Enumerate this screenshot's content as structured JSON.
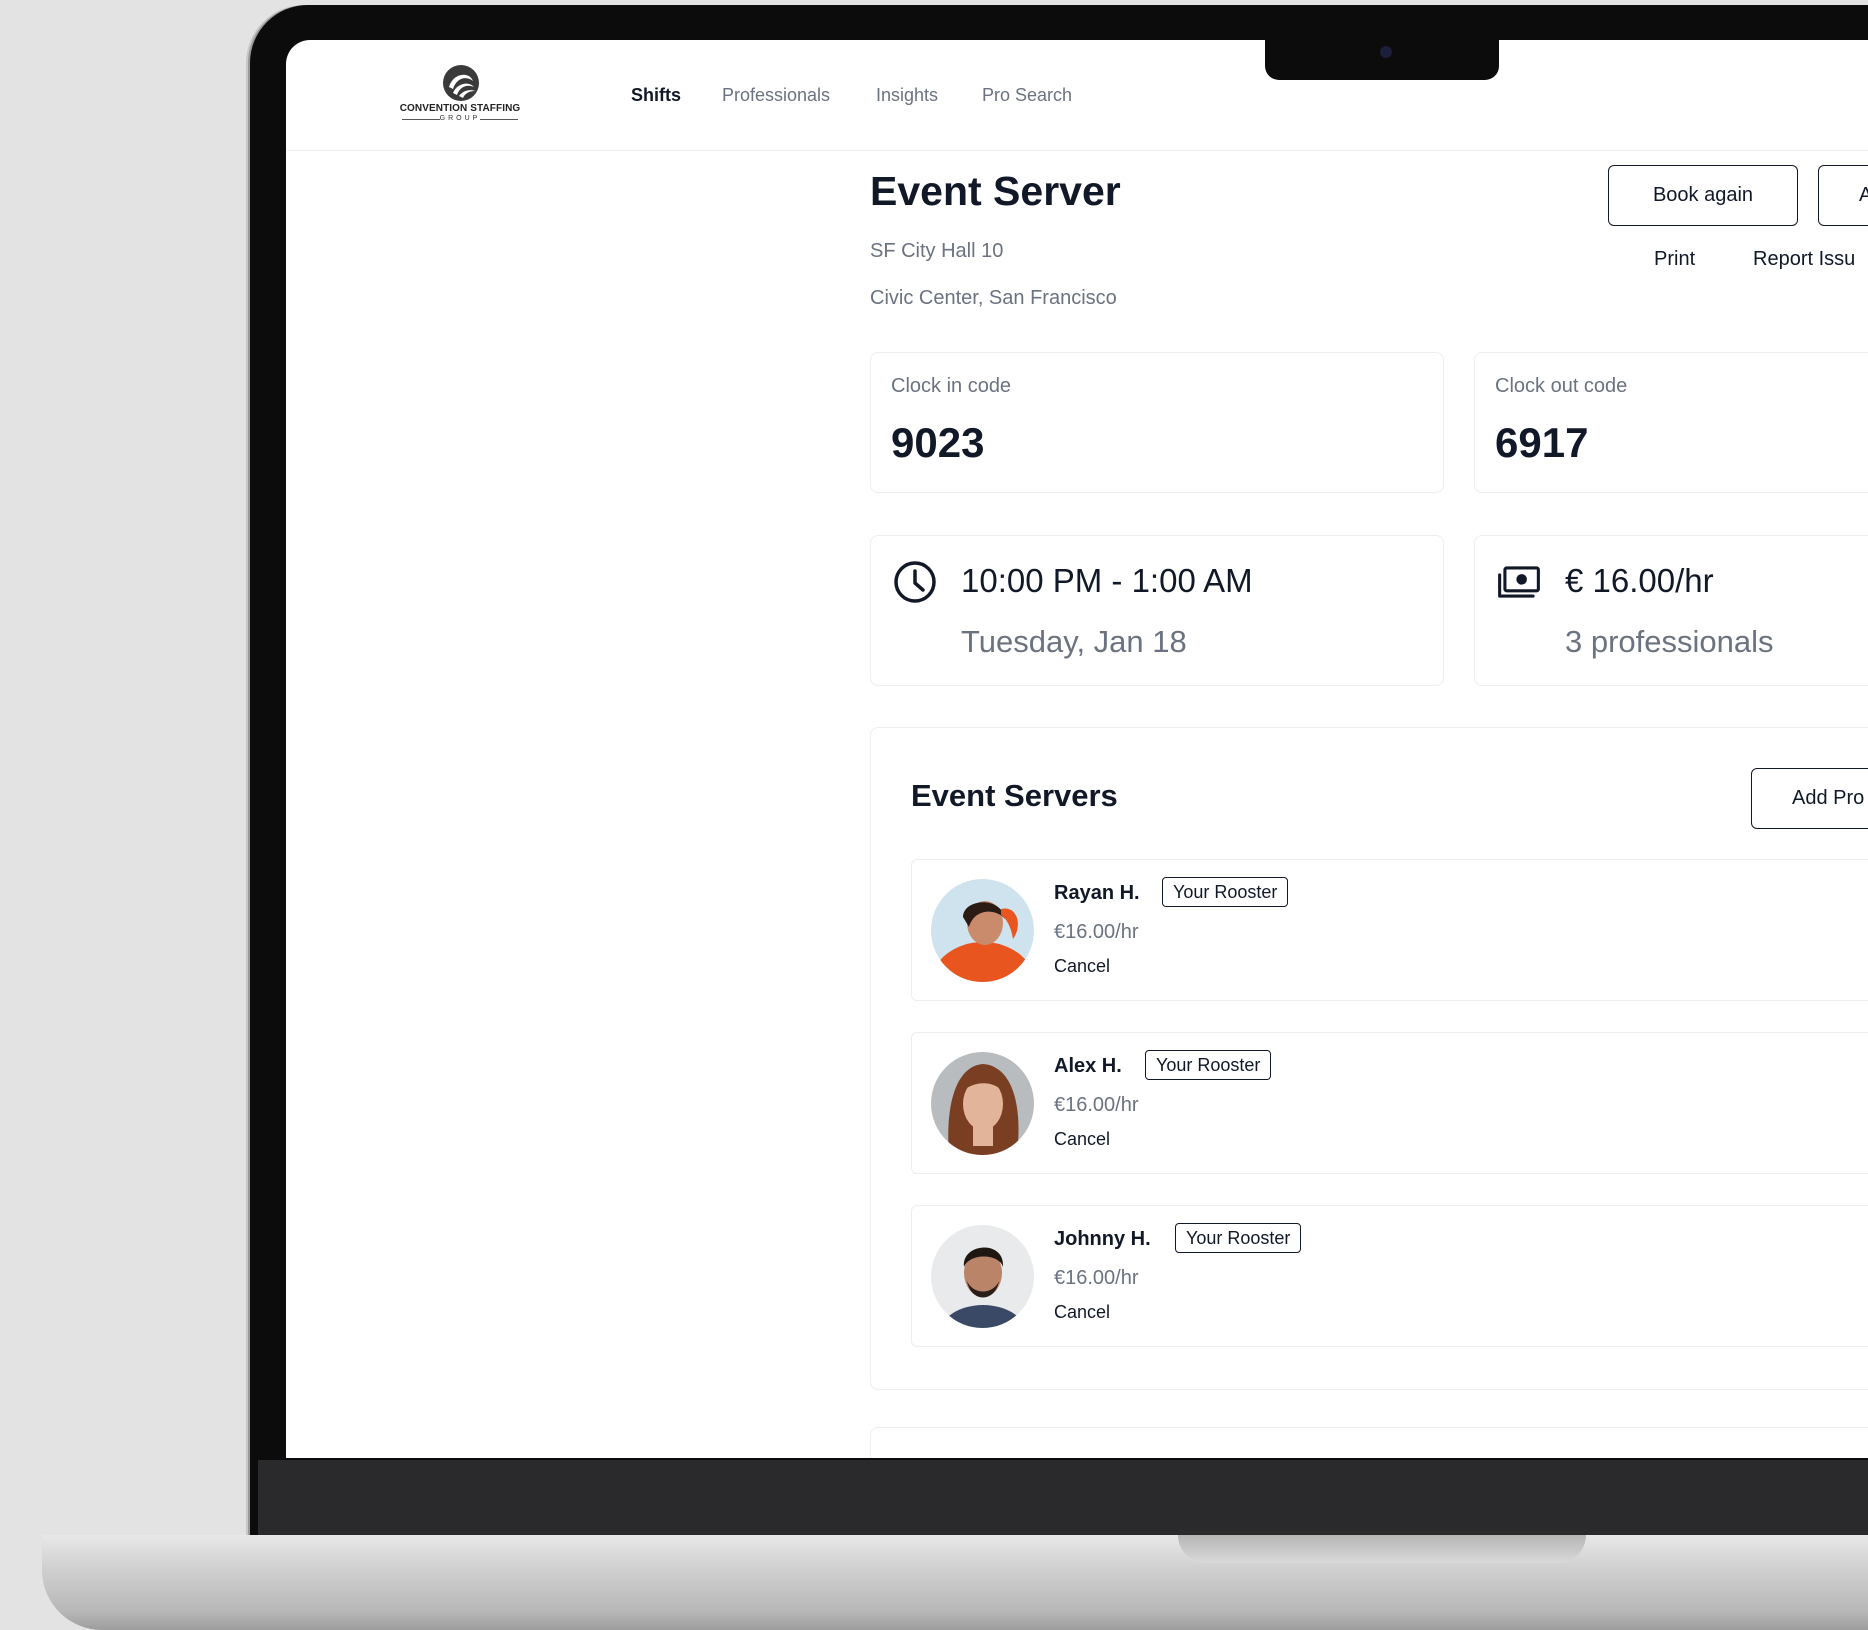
{
  "nav": {
    "logo_text": "CONVENTION STAFFING",
    "logo_sub": "GROUP",
    "items": [
      {
        "label": "Shifts",
        "active": true
      },
      {
        "label": "Professionals",
        "active": false
      },
      {
        "label": "Insights",
        "active": false
      },
      {
        "label": "Pro Search",
        "active": false
      }
    ]
  },
  "shift": {
    "title": "Event Server",
    "venue": "SF City Hall 10",
    "location": "Civic Center, San Francisco"
  },
  "actions": {
    "book_again": "Book again",
    "second_button": "A",
    "print": "Print",
    "report_issue": "Report Issu"
  },
  "codes": {
    "clock_in_label": "Clock in code",
    "clock_in_value": "9023",
    "clock_out_label": "Clock out code",
    "clock_out_value": "6917"
  },
  "details": {
    "time_range": "10:00 PM - 1:00 AM",
    "date": "Tuesday, Jan 18",
    "rate": "€ 16.00/hr",
    "professionals": "3 professionals"
  },
  "panel": {
    "title": "Event Servers",
    "add_button": "Add Pro",
    "pros": [
      {
        "name": "Rayan H.",
        "badge": "Your Rooster",
        "rate": "€16.00/hr",
        "cancel": "Cancel"
      },
      {
        "name": "Alex H.",
        "badge": "Your Rooster",
        "rate": "€16.00/hr",
        "cancel": "Cancel"
      },
      {
        "name": "Johnny H.",
        "badge": "Your Rooster",
        "rate": "€16.00/hr",
        "cancel": "Cancel"
      }
    ]
  },
  "colors": {
    "text_primary": "#111827",
    "text_secondary": "#6b7280",
    "border": "#eceef1"
  }
}
